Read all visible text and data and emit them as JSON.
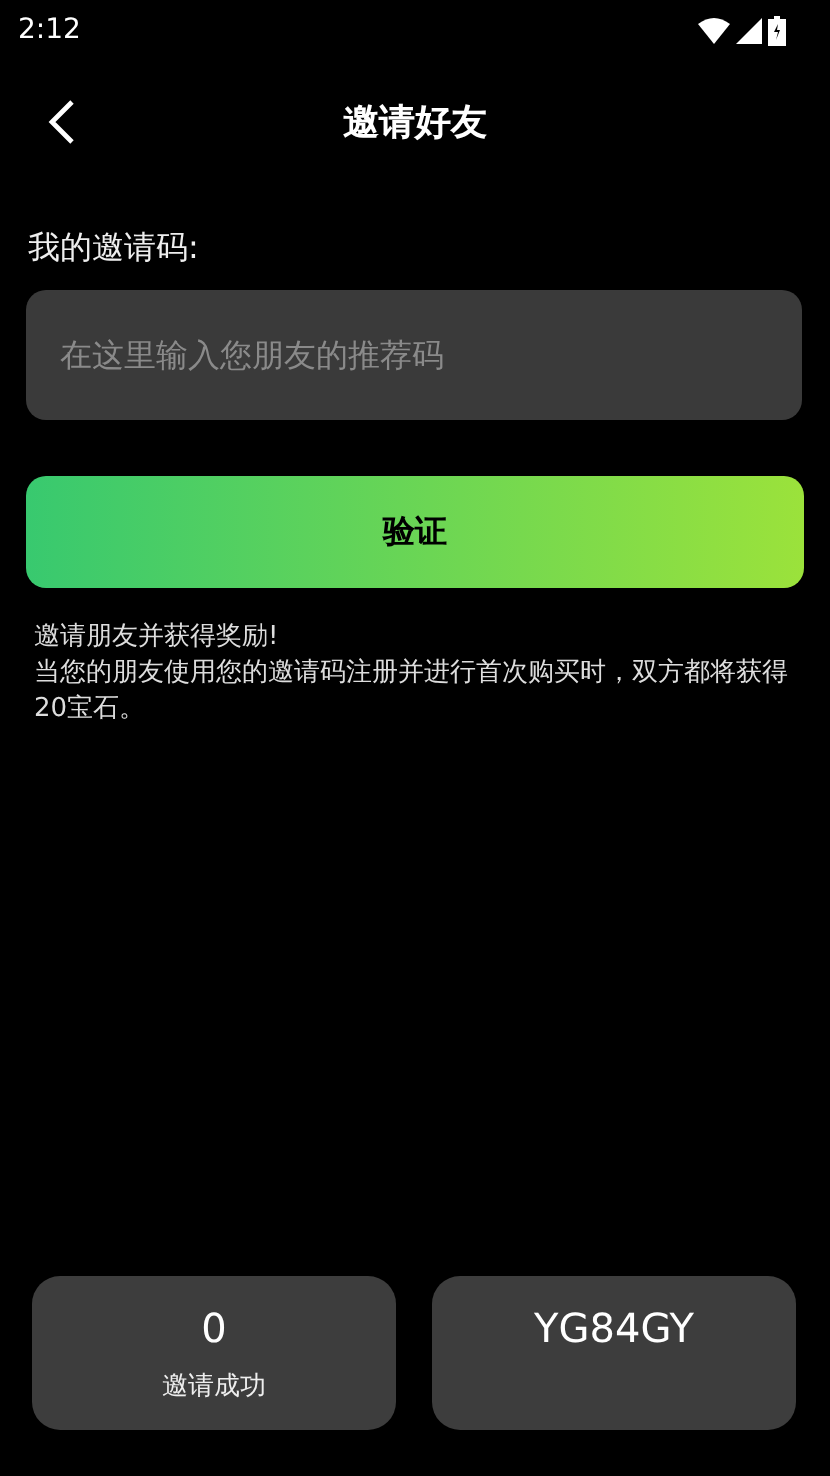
{
  "status_bar": {
    "time": "2:12"
  },
  "header": {
    "title": "邀请好友"
  },
  "invite_code": {
    "label": "我的邀请码:",
    "placeholder": "在这里输入您朋友的推荐码"
  },
  "verify_button": {
    "label": "验证"
  },
  "info": {
    "title": "邀请朋友并获得奖励!",
    "body": "当您的朋友使用您的邀请码注册并进行首次购买时，双方都将获得20宝石。"
  },
  "stats": [
    {
      "value": "0",
      "label": "邀请成功"
    },
    {
      "value": "YG84GY"
    }
  ]
}
